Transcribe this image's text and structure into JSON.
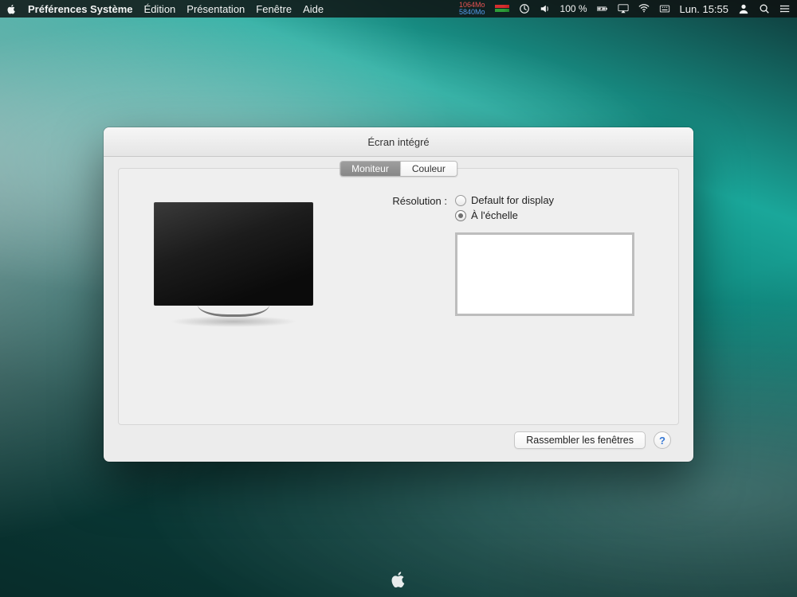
{
  "menubar": {
    "app_name": "Préférences Système",
    "menus": [
      "Édition",
      "Présentation",
      "Fenêtre",
      "Aide"
    ],
    "mem1": "1064Mo",
    "mem2": "5840Mo",
    "battery": "100 %",
    "clock": "Lun. 15:55"
  },
  "window": {
    "title": "Écran intégré",
    "tabs": {
      "monitor": "Moniteur",
      "color": "Couleur"
    },
    "resolution_label": "Résolution :",
    "radio_default": "Default for display",
    "radio_scaled": "À l'échelle",
    "gather_button": "Rassembler les fenêtres",
    "help_char": "?"
  }
}
